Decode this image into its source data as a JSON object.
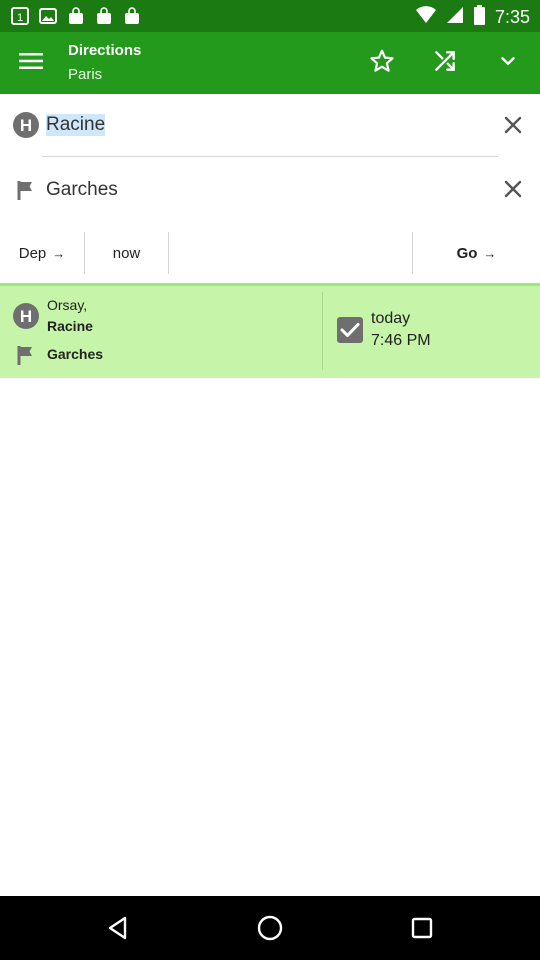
{
  "status_bar": {
    "time": "7:35",
    "icons": [
      "notification-1-icon",
      "image-icon",
      "shopping-bag-icon",
      "shopping-bag-icon",
      "shopping-bag-icon",
      "wifi-icon",
      "signal-icon",
      "battery-icon"
    ]
  },
  "app_bar": {
    "title": "Directions",
    "subtitle": "Paris",
    "icons": [
      "menu-icon",
      "star-icon",
      "shuffle-icon",
      "chevron-down-icon"
    ]
  },
  "from": {
    "value": "Racine",
    "icon": "hotel-h-icon"
  },
  "to": {
    "value": "Garches",
    "icon": "flag-icon"
  },
  "options": {
    "dep_label": "Dep",
    "dep_arrow": "→",
    "when_label": "now",
    "go_label": "Go",
    "go_arrow": "→"
  },
  "result": {
    "from_line1": "Orsay,",
    "from_line2": "Racine",
    "to": "Garches",
    "day": "today",
    "time": "7:46 PM"
  },
  "colors": {
    "status_bar": "#1b7a12",
    "app_bar": "#249a1c",
    "result_bg": "#c6f4a8",
    "selection": "#cfe6fb"
  },
  "nav": {
    "icons": [
      "back-icon",
      "home-icon",
      "recents-icon"
    ]
  }
}
